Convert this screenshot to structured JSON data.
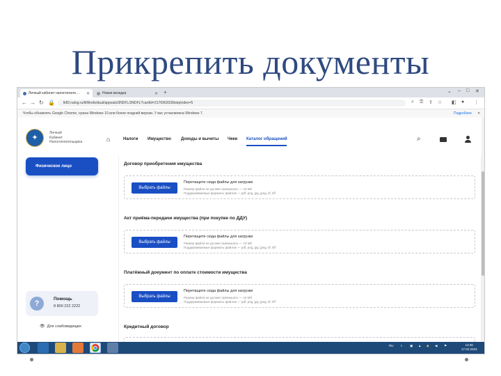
{
  "slide": {
    "title": "Прикрепить документы"
  },
  "browser": {
    "tabs": [
      {
        "label": "Личный кабинет налогоплате…",
        "active": true
      },
      {
        "label": "Новая вкладка",
        "active": false
      }
    ],
    "url": "lkfl2.nalog.ru/lkfl/individual/appeals/3NDFL/3NDFL?cardId=2170962038stepIndex=5",
    "infobar_message": "Чтобы обновлять Google Chrome, нужна Windows 10 или более поздней версии. У вас установлена Windows 7.",
    "infobar_link": "Подробнее"
  },
  "site": {
    "logo_lines": [
      "Личный",
      "Кабинет",
      "Налогоплательщика"
    ],
    "menu": [
      "Налоги",
      "Имущество",
      "Доходы и вычеты",
      "Чеки",
      "Каталог обращений"
    ],
    "active_menu": "Каталог обращений",
    "sidebar": {
      "user_type": "Физическое лицо",
      "help_title": "Помощь",
      "help_phone": "8 800 222 2222",
      "accessibility": "Для слабовидящих"
    },
    "upload": {
      "button_label": "Выбрать файлы",
      "drop_text": "Перетащите сюда файлы для загрузки",
      "size_hint": "Размер файла не должен превышать — 10 Мб",
      "formats_hint": "Поддерживаемые форматы файлов — pdf, png, jpg, jpeg, tif, tiff"
    },
    "sections": [
      {
        "title": "Договор приобретения имущества"
      },
      {
        "title": "Акт приёма-передачи имущества (при покупке по ДДУ)"
      },
      {
        "title": "Платёжный документ по оплате стоимости имущества"
      },
      {
        "title": "Кредитный договор"
      }
    ]
  },
  "taskbar": {
    "lang": "RU",
    "time": "13:30",
    "date": "17.02.2023"
  },
  "colors": {
    "accent": "#1a4fc4",
    "title": "#2f4a80",
    "taskbar": "#1e4a7a"
  }
}
